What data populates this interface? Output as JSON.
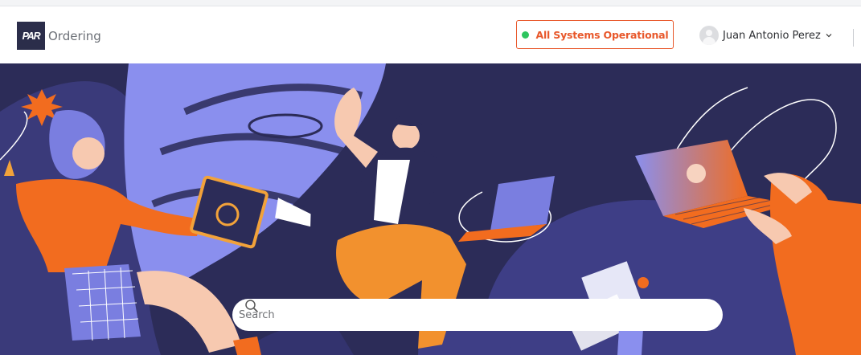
{
  "brand": {
    "logo_text": "PAR",
    "app_name": "Ordering"
  },
  "status": {
    "label": "All Systems Operational",
    "indicator_color": "#2ec55f",
    "accent": "#e8582b"
  },
  "user": {
    "name": "Juan Antonio Perez"
  },
  "search": {
    "placeholder": "Search"
  },
  "icons": {
    "avatar": "user-avatar-icon",
    "chevron": "chevron-down-icon",
    "search": "search-icon"
  },
  "colors": {
    "hero_background": "#2c2c58",
    "illustration_orange": "#f26c1f",
    "illustration_purple": "#7a7ee0"
  }
}
